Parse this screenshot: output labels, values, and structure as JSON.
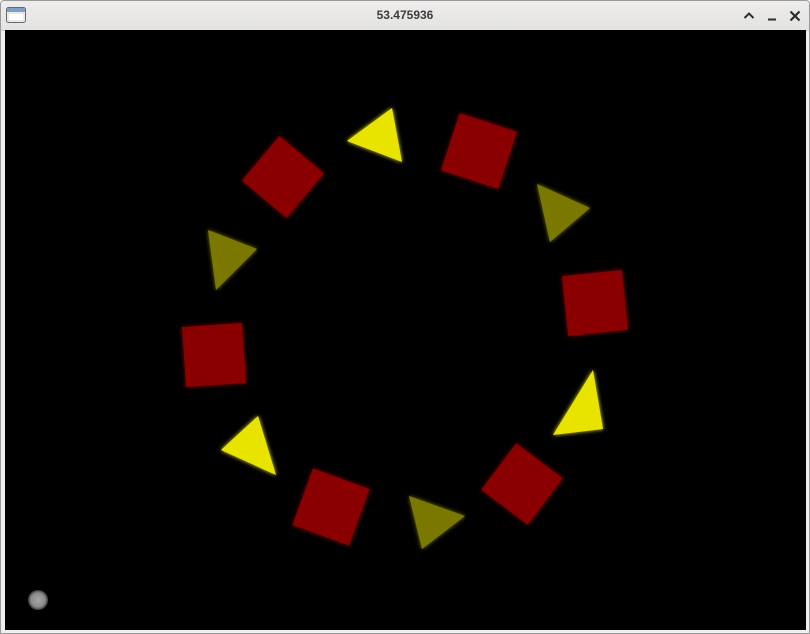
{
  "window": {
    "title": "53.475936",
    "icons": {
      "app": "window-app-icon",
      "maximize": "chevron-up-icon",
      "minimize": "minimize-icon",
      "close": "close-icon"
    }
  },
  "scene": {
    "background": "#000000",
    "colors": {
      "square": "#8a0000",
      "triangle_bright": "#e8e400",
      "triangle_dim": "#7a7800",
      "cursor_dot": "#8f8f8f"
    },
    "shapes": [
      {
        "kind": "square",
        "name": "red-square"
      },
      {
        "kind": "square",
        "name": "red-square"
      },
      {
        "kind": "square",
        "name": "red-square"
      },
      {
        "kind": "square",
        "name": "red-square"
      },
      {
        "kind": "square",
        "name": "red-square"
      },
      {
        "kind": "square",
        "name": "red-square"
      },
      {
        "kind": "triangle",
        "tone": "bright",
        "name": "yellow-triangle"
      },
      {
        "kind": "triangle",
        "tone": "bright",
        "name": "yellow-triangle"
      },
      {
        "kind": "triangle",
        "tone": "bright",
        "name": "yellow-triangle"
      },
      {
        "kind": "triangle",
        "tone": "dim",
        "name": "olive-triangle"
      },
      {
        "kind": "triangle",
        "tone": "dim",
        "name": "olive-triangle"
      },
      {
        "kind": "triangle",
        "tone": "dim",
        "name": "olive-triangle"
      }
    ]
  }
}
